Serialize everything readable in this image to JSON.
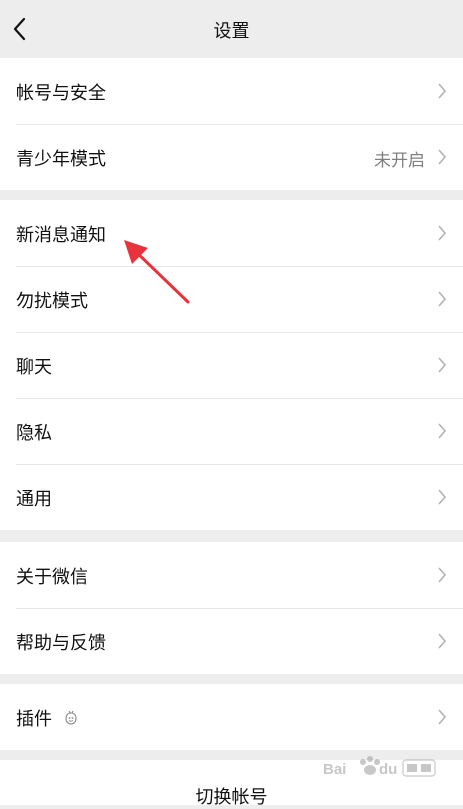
{
  "header": {
    "title": "设置",
    "back_icon": "chevron-left-icon"
  },
  "groups": [
    {
      "items": [
        {
          "label": "帐号与安全",
          "value": ""
        },
        {
          "label": "青少年模式",
          "value": "未开启"
        }
      ]
    },
    {
      "items": [
        {
          "label": "新消息通知"
        },
        {
          "label": "勿扰模式"
        },
        {
          "label": "聊天"
        },
        {
          "label": "隐私"
        },
        {
          "label": "通用"
        }
      ]
    },
    {
      "items": [
        {
          "label": "关于微信"
        },
        {
          "label": "帮助与反馈"
        }
      ]
    },
    {
      "items": [
        {
          "label": "插件",
          "icon": "plugin-icon"
        }
      ]
    }
  ],
  "switch_account": {
    "label": "切换帐号"
  },
  "annotation": {
    "arrow_color": "#e8323c",
    "icon": "red-arrow-annotation"
  },
  "watermark": {
    "icon": "baidu-jingyan-watermark"
  },
  "colors": {
    "background": "#ededed",
    "card": "#ffffff",
    "secondary_text": "#7f7f7f",
    "chevron": "#b2b2b2"
  }
}
